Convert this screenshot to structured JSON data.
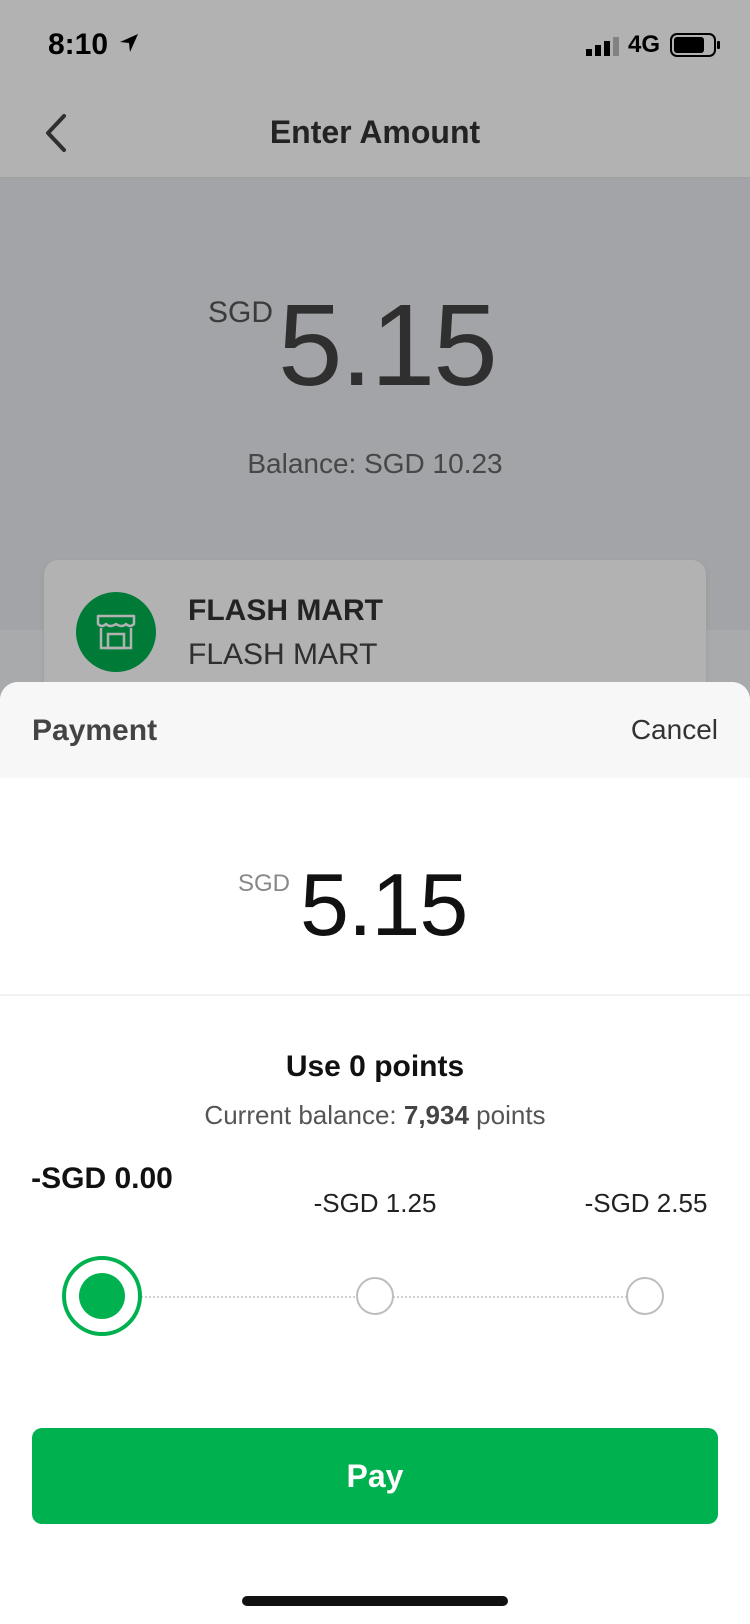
{
  "status_bar": {
    "time": "8:10",
    "network": "4G"
  },
  "nav": {
    "title": "Enter Amount"
  },
  "amount_screen": {
    "currency": "SGD",
    "amount": "5.15",
    "balance": "Balance: SGD 10.23"
  },
  "merchant": {
    "name": "FLASH MART",
    "subtitle": "FLASH MART"
  },
  "payment_sheet": {
    "title": "Payment",
    "cancel_label": "Cancel",
    "currency": "SGD",
    "amount": "5.15",
    "points_title": "Use 0 points",
    "balance_prefix": "Current balance: ",
    "balance_points": "7,934",
    "balance_suffix": " points",
    "options": [
      {
        "label": "-SGD 0.00",
        "selected": true
      },
      {
        "label": "-SGD 1.25",
        "selected": false
      },
      {
        "label": "-SGD 2.55",
        "selected": false
      }
    ],
    "pay_label": "Pay"
  },
  "colors": {
    "accent": "#00b14f"
  }
}
